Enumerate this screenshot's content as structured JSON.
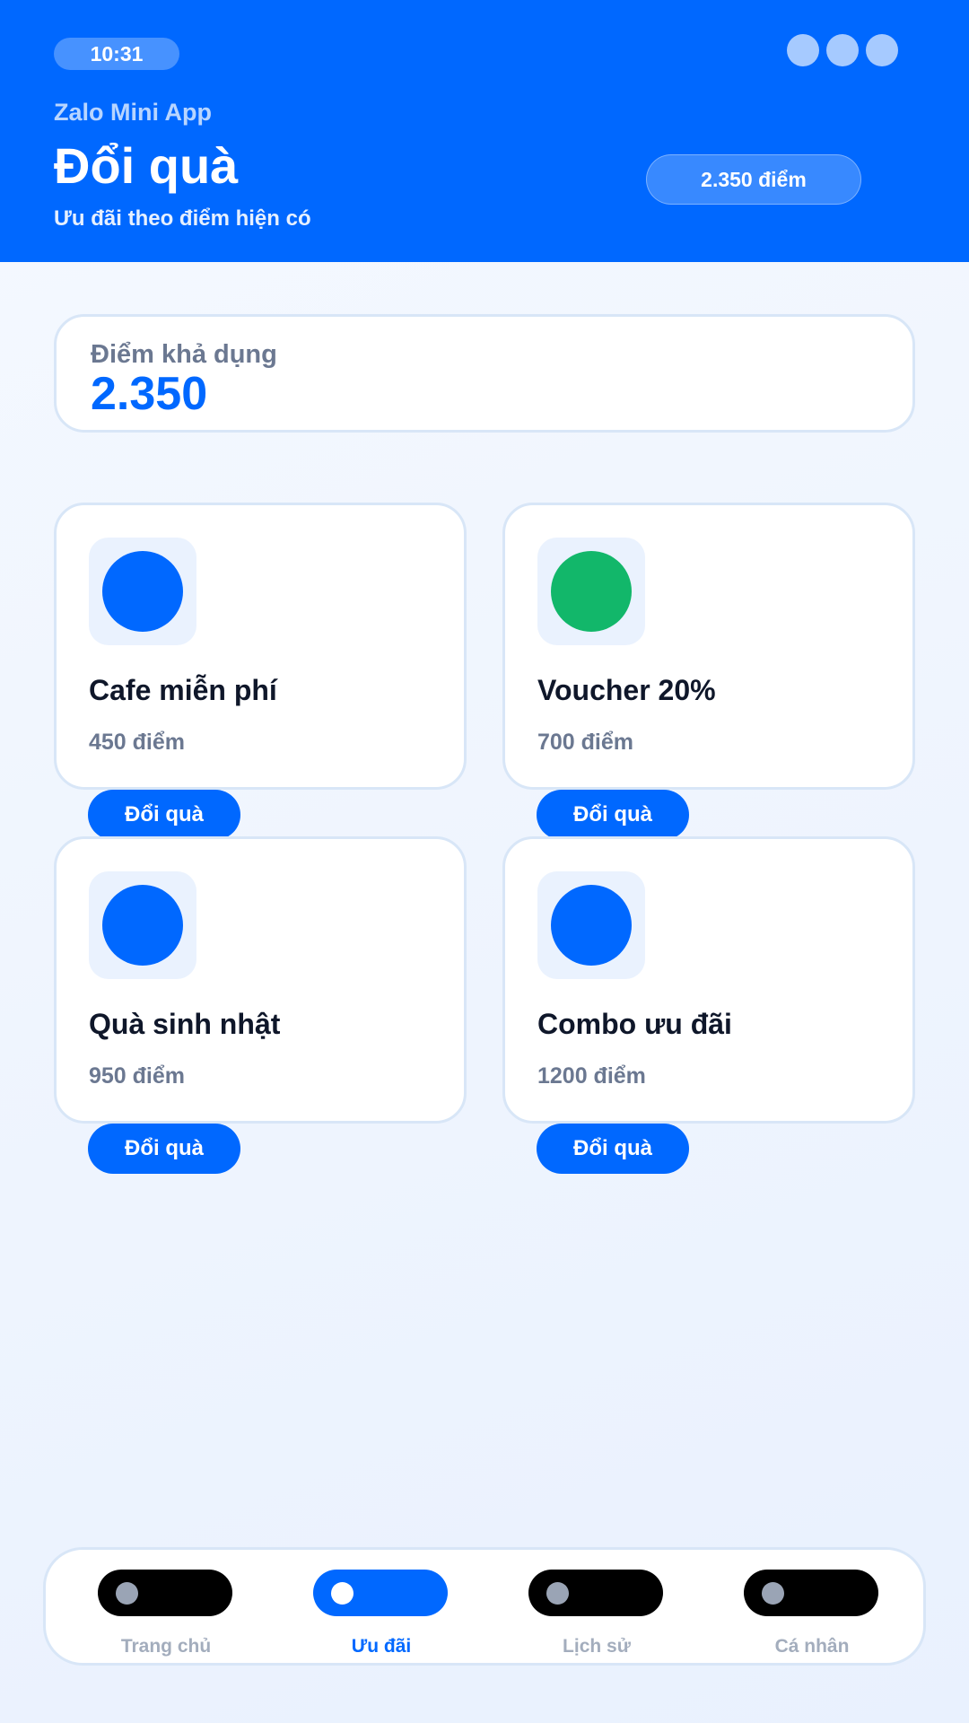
{
  "status_bar": {
    "time": "10:31"
  },
  "header": {
    "app_name": "Zalo Mini App",
    "title": "Đổi quà",
    "subtitle": "Ưu đãi theo điểm hiện có",
    "points_badge": "2.350 điểm"
  },
  "balance": {
    "label": "Điểm khả dụng",
    "value": "2.350"
  },
  "rewards": [
    {
      "title": "Cafe miễn phí",
      "cost": "450 điểm",
      "button": "Đổi quà",
      "icon_color": "#0068ff",
      "icon": "reward-icon"
    },
    {
      "title": "Voucher 20%",
      "cost": "700 điểm",
      "button": "Đổi quà",
      "icon_color": "#12b76a",
      "icon": "voucher-icon"
    },
    {
      "title": "Quà sinh nhật",
      "cost": "950 điểm",
      "button": "Đổi quà",
      "icon_color": "#0068ff",
      "icon": "gift-icon"
    },
    {
      "title": "Combo ưu đãi",
      "cost": "1200 điểm",
      "button": "Đổi quà",
      "icon_color": "#0068ff",
      "icon": "combo-icon"
    }
  ],
  "nav": {
    "active_index": 1,
    "items": [
      {
        "label": "Trang chủ",
        "icon": "home-icon"
      },
      {
        "label": "Ưu đãi",
        "icon": "offer-icon"
      },
      {
        "label": "Lịch sử",
        "icon": "history-icon"
      },
      {
        "label": "Cá nhân",
        "icon": "profile-icon"
      }
    ]
  },
  "colors": {
    "primary": "#0068ff",
    "success": "#12b76a",
    "muted": "#6b7891"
  }
}
